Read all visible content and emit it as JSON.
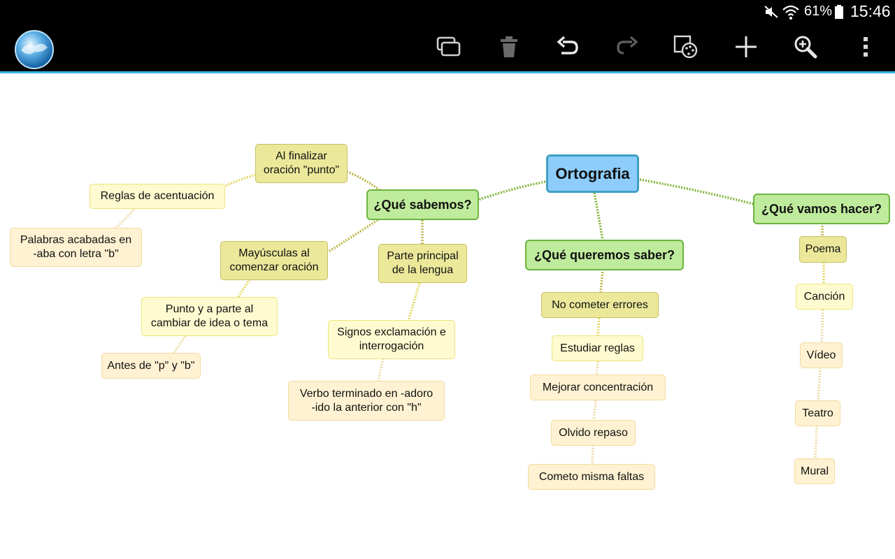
{
  "status_bar": {
    "battery_percent": "61%",
    "time": "15:46",
    "icons": [
      "mute-icon",
      "wifi-icon",
      "battery-icon"
    ]
  },
  "action_bar": {
    "buttons": [
      "window-icon",
      "trash-icon",
      "undo-icon",
      "redo-icon",
      "palette-icon",
      "add-icon",
      "zoom-icon",
      "overflow-menu-icon"
    ],
    "accent_color": "#33b5e5"
  },
  "map": {
    "root": "Ortografia",
    "sabemos": {
      "label": "¿Qué sabemos?",
      "al_finalizar": "Al finalizar\noración \"punto\"",
      "reglas": "Reglas de acentuación",
      "palabras": "Palabras acabadas en\n-aba con letra \"b\"",
      "mayusculas": "Mayúsculas al\ncomenzar oración",
      "punto": "Punto y a parte al\ncambiar de idea o tema",
      "antes": "Antes de \"p\" y \"b\"",
      "parte": "Parte principal\nde la lengua",
      "signos": "Signos exclamación e\ninterrogación",
      "verbo": "Verbo terminado en -adoro\n-ido la anterior con \"h\""
    },
    "queremos": {
      "label": "¿Qué queremos saber?",
      "items": [
        "No cometer errores",
        "Estudiar reglas",
        "Mejorar concentración",
        "Olvido repaso",
        "Cometo misma faltas"
      ]
    },
    "hacer": {
      "label": "¿Qué vamos hacer?",
      "items": [
        "Poema",
        "Canción",
        "Vídeo",
        "Teatro",
        "Mural"
      ]
    }
  },
  "colors": {
    "root_fill": "#8ecdfb",
    "main_fill": "#bfeb9c",
    "level2_fill": "#ebe89a",
    "level3_fill": "#fffbd0",
    "level4_fill": "#fff2d2",
    "link_green": "#7fb73a",
    "link_olive": "#bdb54a",
    "link_yellow": "#e6d762",
    "link_pale": "#efdcaa"
  }
}
